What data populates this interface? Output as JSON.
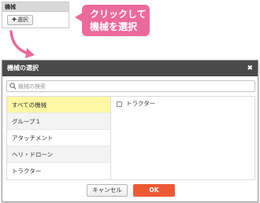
{
  "field": {
    "header": "機械",
    "select_button": {
      "icon": "plus-icon",
      "label": "選択"
    }
  },
  "callout": {
    "line1": "クリックして",
    "line2": "機械を選択",
    "color": "#ec6a9a"
  },
  "modal": {
    "title": "機械の選択",
    "close_icon": "close-icon",
    "search": {
      "placeholder": "機械の検索",
      "value": ""
    },
    "categories": [
      {
        "label": "すべての機械",
        "state": "selected"
      },
      {
        "label": "グループ１",
        "state": "normal"
      },
      {
        "label": "アタッチメント",
        "state": "normal"
      },
      {
        "label": "ヘリ・ドローン",
        "state": "normal"
      },
      {
        "label": "トラクター",
        "state": "normal"
      }
    ],
    "machines": [
      {
        "label": "トラクター",
        "checked": false
      }
    ],
    "cancel_label": "キャンセル",
    "ok_label": "OK",
    "colors": {
      "header": "#4a4a4a",
      "selected_category": "#fff7a3",
      "ok": "#ec5a34"
    }
  }
}
